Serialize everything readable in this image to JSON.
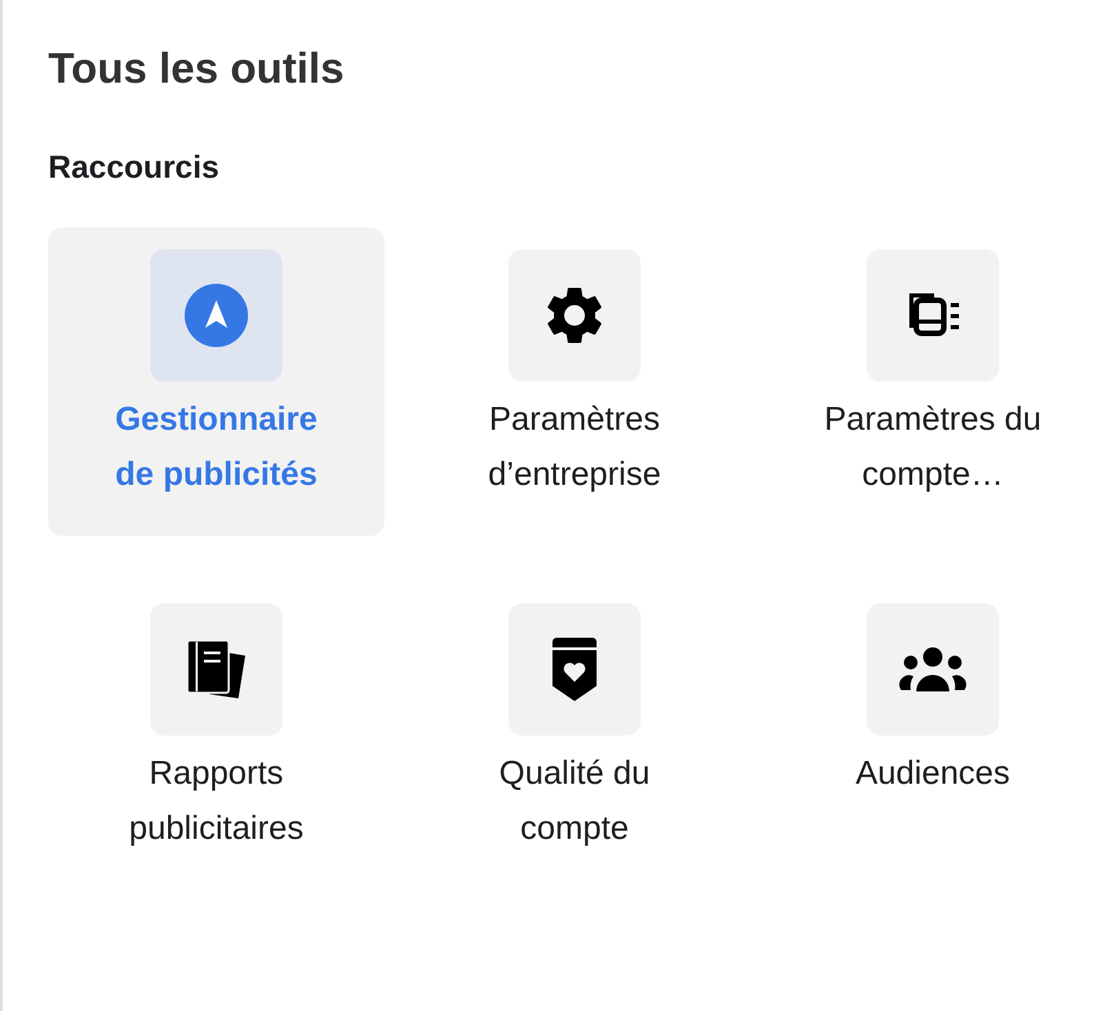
{
  "title": "Tous les outils",
  "section": "Raccourcis",
  "shortcuts": [
    {
      "kind": "ads",
      "label": "Gestionnaire de publicités",
      "selected": true
    },
    {
      "kind": "gear",
      "label": "Paramètres d’entreprise",
      "selected": false
    },
    {
      "kind": "account",
      "label": "Paramètres du compte…",
      "selected": false
    },
    {
      "kind": "reports",
      "label": "Rapports publicitaires",
      "selected": false
    },
    {
      "kind": "quality",
      "label": "Qualité du compte",
      "selected": false
    },
    {
      "kind": "people",
      "label": "Audiences",
      "selected": false
    }
  ]
}
